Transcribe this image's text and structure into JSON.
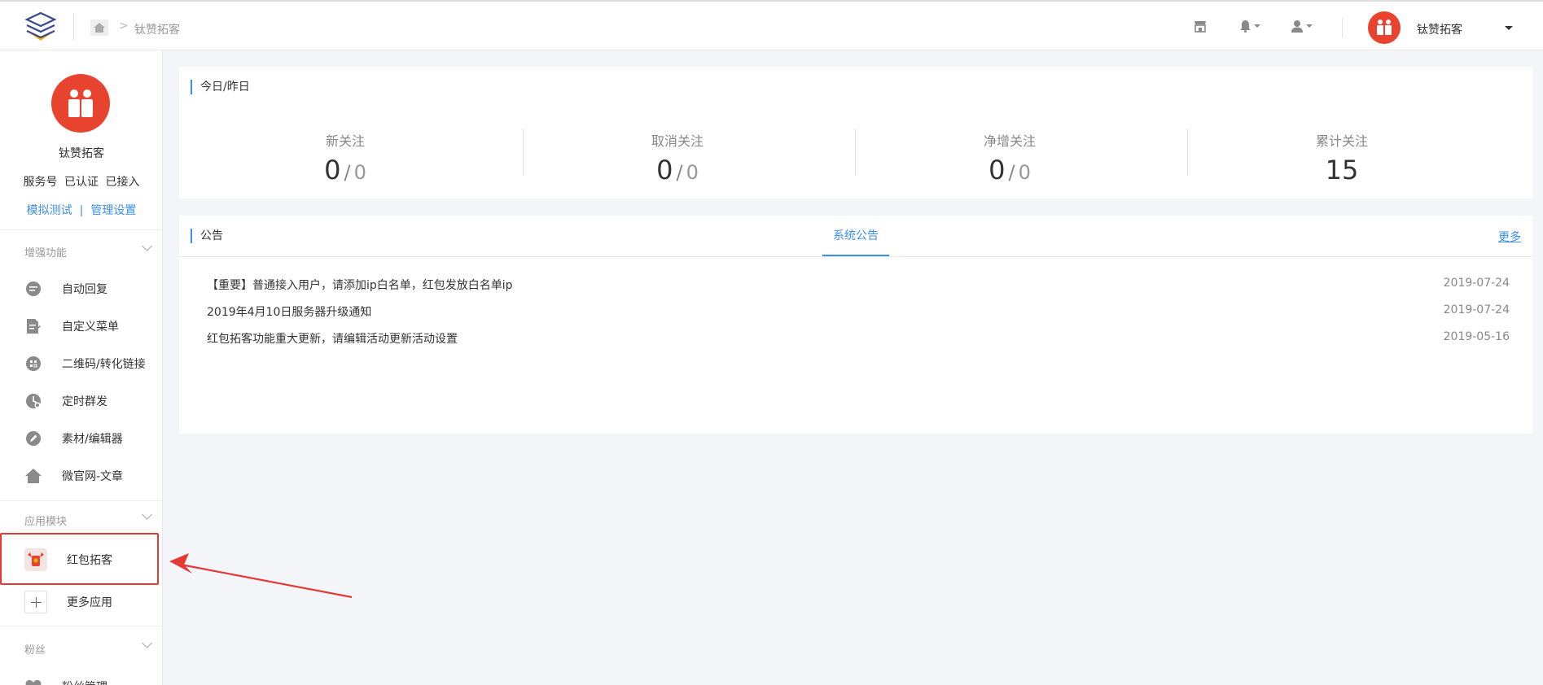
{
  "topbar": {
    "breadcrumb_current": "钛赞拓客",
    "breadcrumb_sep": ">",
    "account_name": "钛赞拓客"
  },
  "sidebar": {
    "account_name": "钛赞拓客",
    "tags": [
      "服务号",
      "已认证",
      "已接入"
    ],
    "links": {
      "simulate": "模拟测试",
      "separator": "|",
      "settings": "管理设置"
    },
    "groups": [
      {
        "title": "增强功能",
        "items": [
          {
            "label": "自动回复",
            "icon": "chat-bubble-icon"
          },
          {
            "label": "自定义菜单",
            "icon": "document-edit-icon"
          },
          {
            "label": "二维码/转化链接",
            "icon": "qrcode-icon"
          },
          {
            "label": "定时群发",
            "icon": "clock-icon"
          },
          {
            "label": "素材/编辑器",
            "icon": "pencil-icon"
          },
          {
            "label": "微官网-文章",
            "icon": "home-icon"
          }
        ]
      },
      {
        "title": "应用模块",
        "items": [
          {
            "label": "红包拓客",
            "icon": "red-packet-app-icon"
          },
          {
            "label": "更多应用",
            "icon": "plus-icon"
          }
        ]
      },
      {
        "title": "粉丝",
        "items": [
          {
            "label": "粉丝管理",
            "icon": "heart-icon"
          }
        ]
      }
    ]
  },
  "stats": {
    "title": "今日/昨日",
    "items": [
      {
        "label": "新关注",
        "today": "0",
        "yesterday": "0"
      },
      {
        "label": "取消关注",
        "today": "0",
        "yesterday": "0"
      },
      {
        "label": "净增关注",
        "today": "0",
        "yesterday": "0"
      },
      {
        "label": "累计关注",
        "total": "15"
      }
    ]
  },
  "notices": {
    "title": "公告",
    "tab": "系统公告",
    "more": "更多",
    "items": [
      {
        "text": "【重要】普通接入用户，请添加ip白名单，红包发放白名单ip",
        "date": "2019-07-24"
      },
      {
        "text": "2019年4月10日服务器升级通知",
        "date": "2019-07-24"
      },
      {
        "text": "红包拓客功能重大更新，请编辑活动更新活动设置",
        "date": "2019-05-16"
      }
    ]
  },
  "colors": {
    "accent": "#3b8ff0",
    "brand_red": "#e8432f",
    "highlight": "#e53935"
  }
}
